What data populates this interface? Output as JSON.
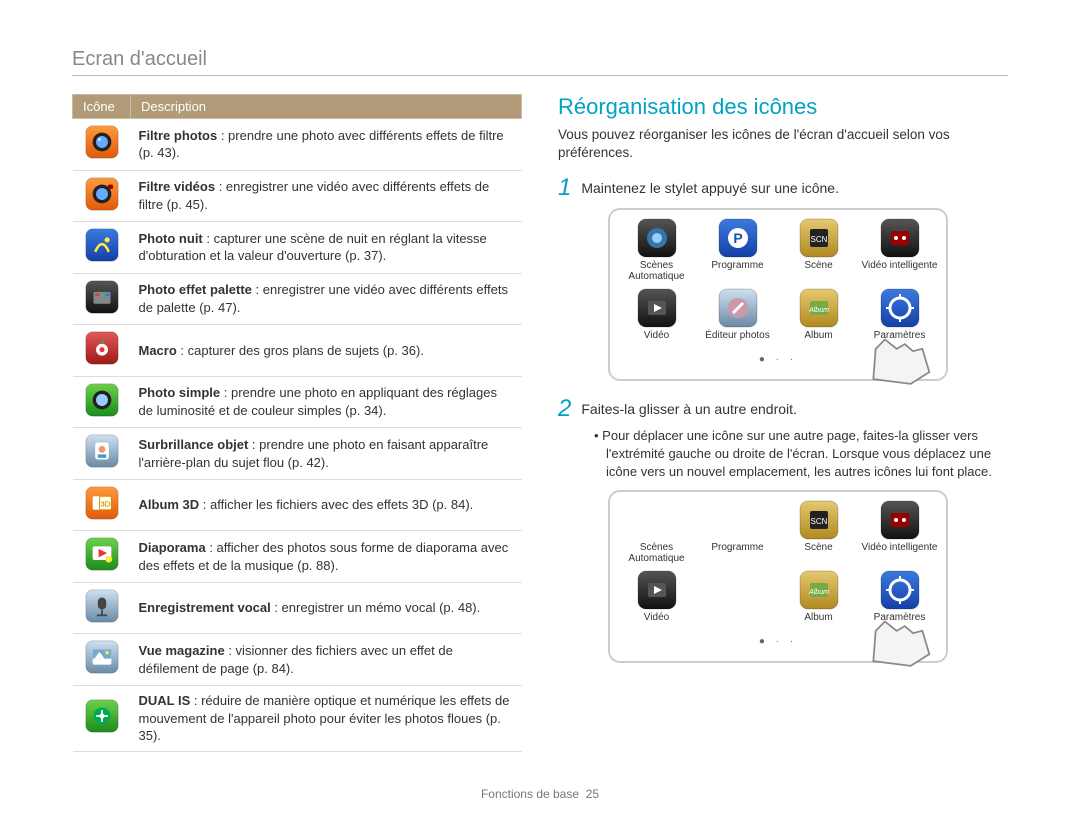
{
  "header": "Ecran d'accueil",
  "table": {
    "headers": {
      "icon": "Icône",
      "desc": "Description"
    },
    "rows": [
      {
        "bold": "Filtre photos",
        "rest": " : prendre une photo avec différents effets de filtre (p. 43)."
      },
      {
        "bold": "Filtre vidéos",
        "rest": " : enregistrer une vidéo avec différents effets de filtre (p. 45)."
      },
      {
        "bold": "Photo nuit",
        "rest": " : capturer une scène de nuit en réglant la vitesse d'obturation et la valeur d'ouverture (p. 37)."
      },
      {
        "bold": "Photo effet palette",
        "rest": " : enregistrer une vidéo avec différents effets de palette (p. 47)."
      },
      {
        "bold": "Macro",
        "rest": " : capturer des gros plans de sujets (p. 36)."
      },
      {
        "bold": "Photo simple",
        "rest": " : prendre une photo en appliquant des réglages de luminosité et de couleur simples (p. 34)."
      },
      {
        "bold": "Surbrillance objet",
        "rest": " : prendre une photo en faisant apparaître l'arrière-plan du sujet flou (p. 42)."
      },
      {
        "bold": "Album 3D",
        "rest": " : afficher les fichiers avec des effets 3D (p. 84)."
      },
      {
        "bold": "Diaporama",
        "rest": " : afficher des photos sous forme de diaporama avec des effets et de la musique (p. 88)."
      },
      {
        "bold": "Enregistrement vocal",
        "rest": " : enregistrer un mémo vocal (p. 48)."
      },
      {
        "bold": "Vue magazine",
        "rest": " : visionner des fichiers avec un effet de défilement de page (p. 84)."
      },
      {
        "bold": "DUAL IS",
        "rest": " : réduire de manière optique et numérique les effets de mouvement de l'appareil photo pour éviter les photos floues (p. 35)."
      }
    ]
  },
  "right": {
    "title": "Réorganisation des icônes",
    "intro": "Vous pouvez réorganiser les icônes de l'écran d'accueil selon vos préférences.",
    "step1_num": "1",
    "step1_text": "Maintenez le stylet appuyé sur une icône.",
    "step2_num": "2",
    "step2_text": "Faites-la glisser à un autre endroit.",
    "step2_sub": "Pour déplacer une icône sur une autre page, faites-la glisser vers l'extrémité gauche ou droite de l'écran. Lorsque vous déplacez une icône vers un nouvel emplacement, les autres icônes lui font place.",
    "mock1_apps": [
      {
        "label": "Scènes Automatique"
      },
      {
        "label": "Programme"
      },
      {
        "label": "Scène"
      },
      {
        "label": "Vidéo intelligente"
      },
      {
        "label": "Vidéo"
      },
      {
        "label": "Éditeur photos"
      },
      {
        "label": "Album"
      },
      {
        "label": "Paramètres"
      }
    ],
    "mock2_apps": [
      {
        "label": "Scènes Automatique"
      },
      {
        "label": "Programme"
      },
      {
        "label": "Scène"
      },
      {
        "label": "Vidéo intelligente"
      },
      {
        "label": "Vidéo"
      },
      {
        "label": ""
      },
      {
        "label": "Album"
      },
      {
        "label": "Paramètres"
      }
    ],
    "dots": "● · ·"
  },
  "footer": {
    "label": "Fonctions de base",
    "page": "25"
  }
}
